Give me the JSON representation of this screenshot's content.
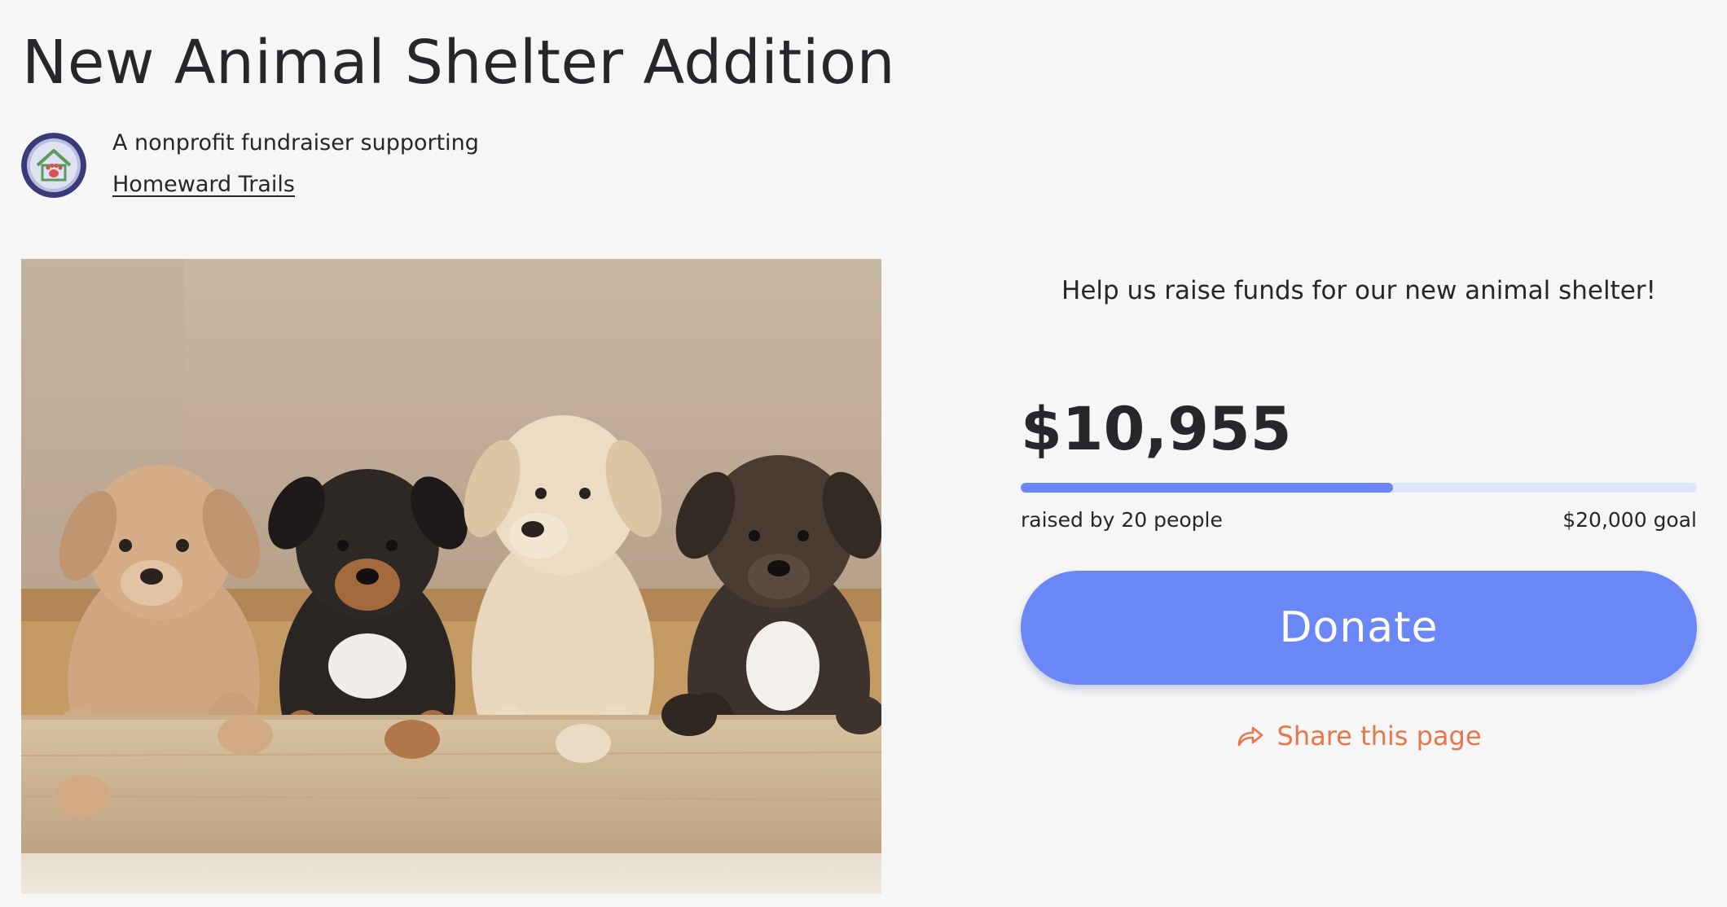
{
  "campaign": {
    "title": "New Animal Shelter Addition",
    "org_caption": "A nonprofit fundraiser supporting",
    "org_name": "Homeward Trails",
    "tagline": "Help us raise funds for our new animal shelter!"
  },
  "progress": {
    "raised": "$10,955",
    "fraction": 0.55,
    "raised_by": "raised by 20 people",
    "goal": "$20,000 goal"
  },
  "actions": {
    "donate_label": "Donate",
    "share_label": "Share this page"
  },
  "icons": {
    "logo": "shelter-logo-icon",
    "share": "share-arrow-icon"
  },
  "colors": {
    "accent": "#6b86f5",
    "progress_track": "#dfe5fb",
    "share": "#e8764a",
    "text": "#26262b",
    "background": "#f6f6f6"
  }
}
